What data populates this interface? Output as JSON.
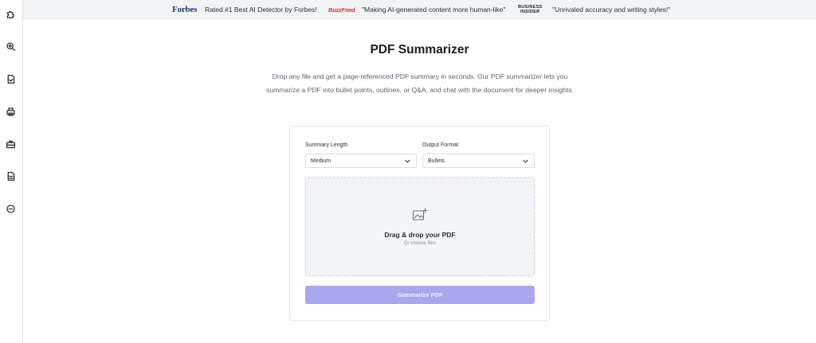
{
  "sidebar": {
    "items": [
      {
        "icon": "puzzle-icon"
      },
      {
        "icon": "search-zoom-icon"
      },
      {
        "icon": "document-check-icon"
      },
      {
        "icon": "printer-icon"
      },
      {
        "icon": "briefcase-icon"
      },
      {
        "icon": "document-text-icon"
      },
      {
        "icon": "minus-circle-icon"
      }
    ]
  },
  "banner": {
    "forbes_logo": "Forbes",
    "forbes_quote": "Rated #1 Best AI Detector by Forbes!",
    "buzzfeed_logo": "BuzzFeed",
    "buzzfeed_quote": "\"Making AI-generated content more human-like\"",
    "bi_logo_line1": "BUSINESS",
    "bi_logo_line2": "INSIDER",
    "bi_quote": "\"Unrivaled accuracy and writing styles!\""
  },
  "main": {
    "title": "PDF Summarizer",
    "description": "Drop any file and get a page-referenced PDF summary in seconds. Our PDF summarizer lets you summarize a PDF into bullet points, outlines, or Q&A, and chat with the document for deeper insights."
  },
  "form": {
    "summary_length_label": "Summary Length",
    "summary_length_value": "Medium",
    "output_format_label": "Output Format",
    "output_format_value": "Bullets",
    "dropzone_title": "Drag & drop your PDF",
    "dropzone_subtitle": "Or choose files",
    "submit_label": "Summarize PDF"
  },
  "colors": {
    "accent_button": "#a8a6ee",
    "banner_bg": "#f2f3f5",
    "forbes_blue": "#1d3a6e",
    "buzzfeed_red": "#e4322b"
  }
}
